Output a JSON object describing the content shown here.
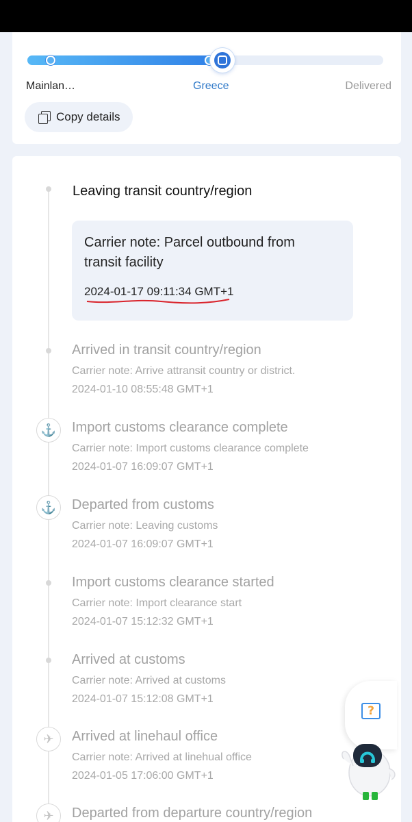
{
  "progress": {
    "origin_label": "Mainlan…",
    "current_label": "Greece",
    "destination_label": "Delivered",
    "fill_fraction": 0.55,
    "copy_button_label": "Copy details"
  },
  "active_event": {
    "title": "Leaving transit country/region",
    "note": "Carrier note: Parcel outbound from transit facility",
    "time": "2024-01-17 09:11:34 GMT+1"
  },
  "events": [
    {
      "title": "Arrived in transit country/region",
      "note": "Carrier note: Arrive attransit country or district.",
      "time": "2024-01-10 08:55:48 GMT+1",
      "icon": "dot"
    },
    {
      "title": "Import customs clearance complete",
      "note": "Carrier note: Import customs clearance complete",
      "time": "2024-01-07 16:09:07 GMT+1",
      "icon": "anchor-icon"
    },
    {
      "title": "Departed from customs",
      "note": "Carrier note: Leaving customs",
      "time": "2024-01-07 16:09:07 GMT+1",
      "icon": "anchor-icon"
    },
    {
      "title": "Import customs clearance started",
      "note": "Carrier note: Import clearance start",
      "time": "2024-01-07 15:12:32 GMT+1",
      "icon": "dot"
    },
    {
      "title": "Arrived at customs",
      "note": "Carrier note: Arrived at customs",
      "time": "2024-01-07 15:12:08 GMT+1",
      "icon": "dot"
    },
    {
      "title": "Arrived at linehaul office",
      "note": "Carrier note: Arrived at linehual office",
      "time": "2024-01-05 17:06:00 GMT+1",
      "icon": "airplane-icon"
    },
    {
      "title": "Departed from departure country/region",
      "note": "",
      "time": "",
      "icon": "airplane-icon"
    }
  ],
  "helper": {
    "help_glyph": "?",
    "accent_color": "#3b8ee6"
  }
}
